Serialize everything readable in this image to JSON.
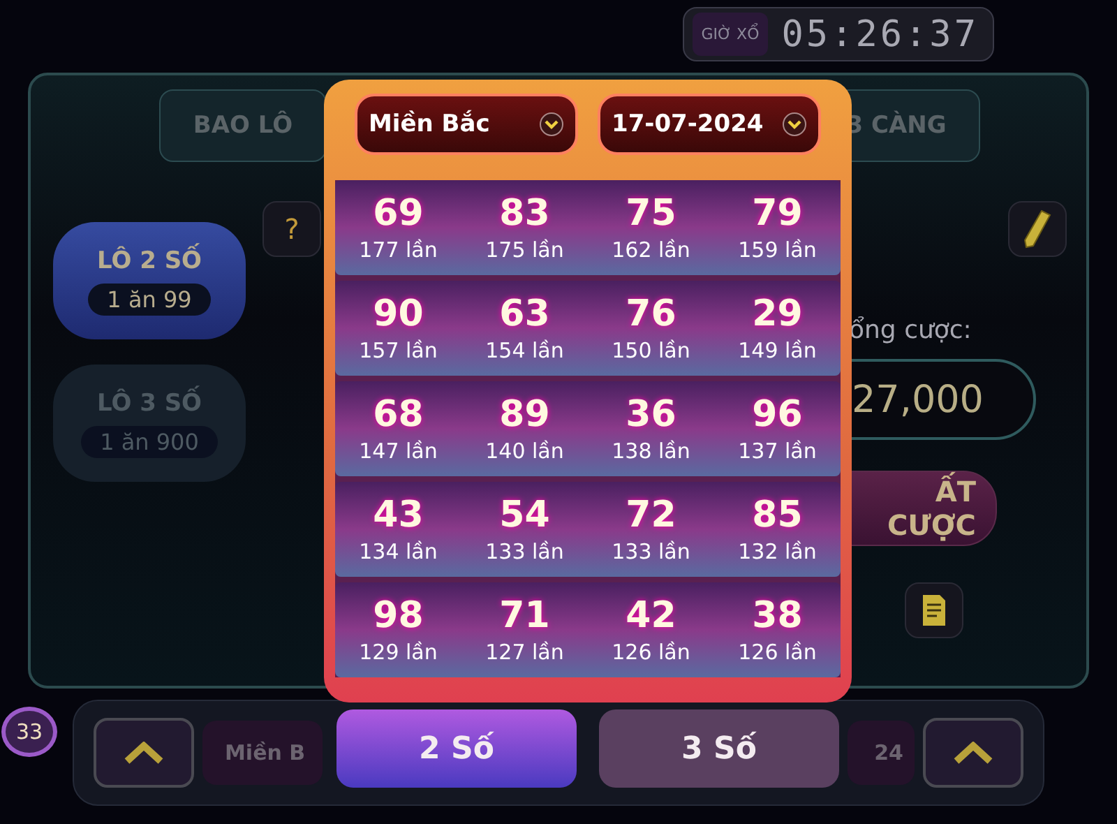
{
  "timer": {
    "label": "GIỜ XỔ",
    "time": "05:26:37"
  },
  "bet_tabs": [
    {
      "label": "BAO LÔ",
      "selected": false
    },
    {
      "label": "3 CÀNG",
      "selected": false
    }
  ],
  "bet_types": [
    {
      "title": "LÔ 2 SỐ",
      "odds": "1 ăn 99",
      "selected": true
    },
    {
      "title": "LÔ 3 SỐ",
      "odds": "1 ăn 900",
      "selected": false
    }
  ],
  "help_button": "?",
  "total_label": "ổng cược:",
  "total_amount": "27,000",
  "place_bet_button": "ẤT CƯỢC",
  "player_badge": "33",
  "bottom_bar": {
    "region": "Miền B",
    "date": "24"
  },
  "stats_popup": {
    "region": "Miền Bắc",
    "date": "17-07-2024",
    "numbers": [
      {
        "number": "69",
        "count": "177 lần"
      },
      {
        "number": "83",
        "count": "175 lần"
      },
      {
        "number": "75",
        "count": "162 lần"
      },
      {
        "number": "79",
        "count": "159 lần"
      },
      {
        "number": "90",
        "count": "157 lần"
      },
      {
        "number": "63",
        "count": "154 lần"
      },
      {
        "number": "76",
        "count": "150 lần"
      },
      {
        "number": "29",
        "count": "149 lần"
      },
      {
        "number": "68",
        "count": "147 lần"
      },
      {
        "number": "89",
        "count": "140 lần"
      },
      {
        "number": "36",
        "count": "138 lần"
      },
      {
        "number": "96",
        "count": "137 lần"
      },
      {
        "number": "43",
        "count": "134 lần"
      },
      {
        "number": "54",
        "count": "133 lần"
      },
      {
        "number": "72",
        "count": "133 lần"
      },
      {
        "number": "85",
        "count": "132 lần"
      },
      {
        "number": "98",
        "count": "129 lần"
      },
      {
        "number": "71",
        "count": "127 lần"
      },
      {
        "number": "42",
        "count": "126 lần"
      },
      {
        "number": "38",
        "count": "126 lần"
      }
    ],
    "tabs": [
      {
        "label": "2 Số",
        "selected": true
      },
      {
        "label": "3 Số",
        "selected": false
      }
    ]
  }
}
